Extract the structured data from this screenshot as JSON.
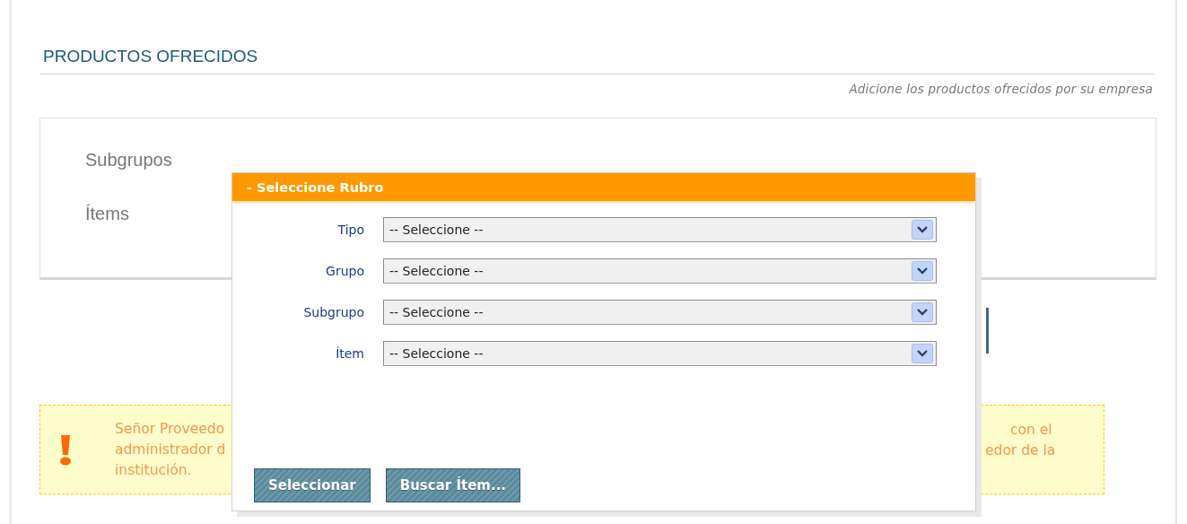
{
  "page": {
    "title": "PRODUCTOS OFRECIDOS",
    "subtitle": "Adicione los productos ofrecidos por su empresa"
  },
  "panel": {
    "labels": [
      "Subgrupos",
      "Ítems"
    ]
  },
  "dialog": {
    "title": "- Seleccione Rubro",
    "fields": [
      {
        "label": "Tipo",
        "value": "-- Seleccione --"
      },
      {
        "label": "Grupo",
        "value": "-- Seleccione --"
      },
      {
        "label": "Subgrupo",
        "value": "-- Seleccione --"
      },
      {
        "label": "Ítem",
        "value": "-- Seleccione --"
      }
    ],
    "buttons": [
      "Seleccionar",
      "Buscar Ítem..."
    ]
  },
  "notice": {
    "left_lines": [
      "Señor Proveedo",
      "administrador d",
      "institución."
    ],
    "right_lines": [
      "con el",
      "edor de la"
    ]
  }
}
